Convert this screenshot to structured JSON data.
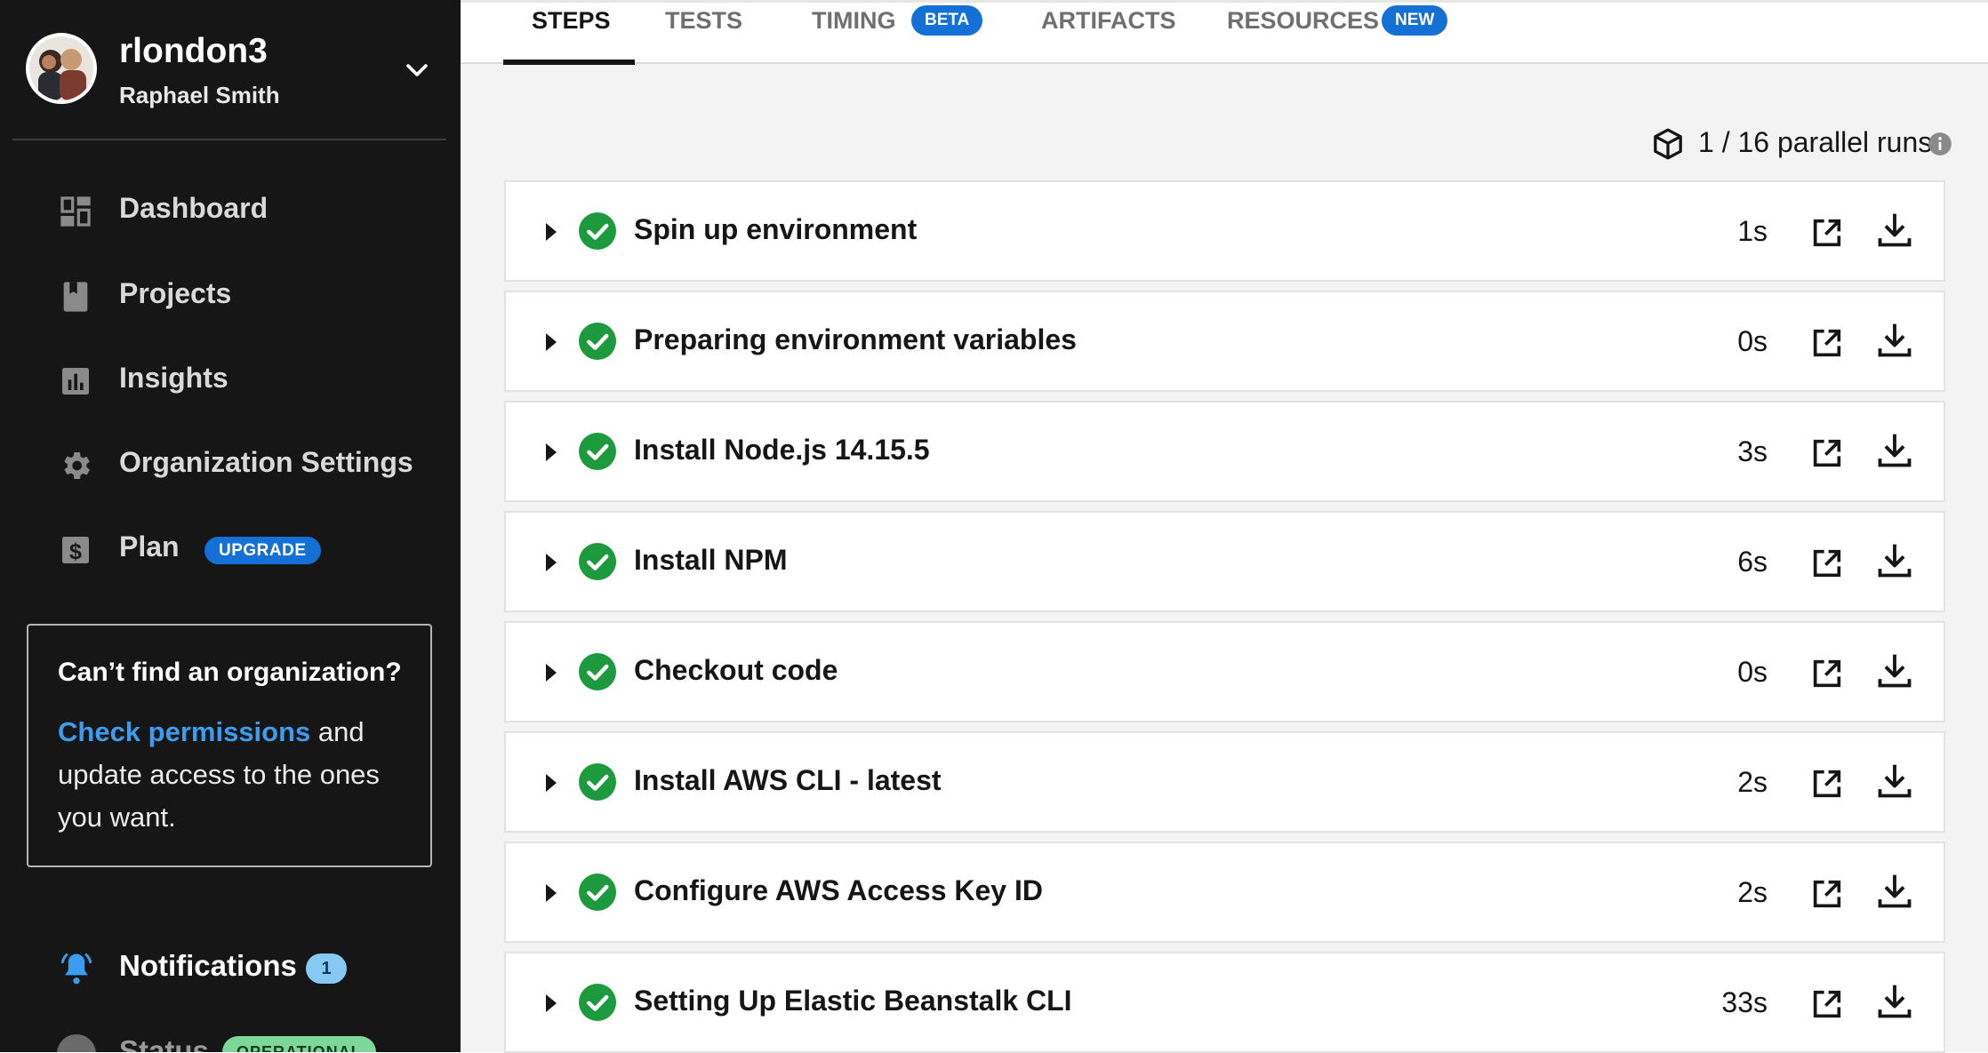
{
  "user": {
    "username": "rlondon3",
    "fullname": "Raphael Smith"
  },
  "sidebar": {
    "items": [
      {
        "label": "Dashboard",
        "icon": "dashboard-icon"
      },
      {
        "label": "Projects",
        "icon": "book-icon"
      },
      {
        "label": "Insights",
        "icon": "bar-chart-icon"
      },
      {
        "label": "Organization Settings",
        "icon": "gear-icon"
      },
      {
        "label": "Plan",
        "icon": "dollar-icon",
        "badge": "UPGRADE"
      }
    ],
    "org_card": {
      "title": "Can’t find an organization?",
      "link": "Check permissions",
      "text": " and update access to the ones you want."
    },
    "notifications": {
      "label": "Notifications",
      "count": "1"
    },
    "status": {
      "label": "Status",
      "badge": "OPERATIONAL"
    }
  },
  "tabs": [
    {
      "label": "STEPS",
      "active": true
    },
    {
      "label": "TESTS"
    },
    {
      "label": "TIMING",
      "badge": "BETA"
    },
    {
      "label": "ARTIFACTS"
    },
    {
      "label": "RESOURCES",
      "badge": "NEW"
    }
  ],
  "parallel_runs": "1 / 16 parallel runs",
  "steps": [
    {
      "name": "Spin up environment",
      "time": "1s"
    },
    {
      "name": "Preparing environment variables",
      "time": "0s"
    },
    {
      "name": "Install Node.js 14.15.5",
      "time": "3s"
    },
    {
      "name": "Install NPM",
      "time": "6s"
    },
    {
      "name": "Checkout code",
      "time": "0s"
    },
    {
      "name": "Install AWS CLI - latest",
      "time": "2s"
    },
    {
      "name": "Configure AWS Access Key ID",
      "time": "2s"
    },
    {
      "name": "Setting Up Elastic Beanstalk CLI",
      "time": "33s"
    }
  ],
  "colors": {
    "success": "#1e9a3e",
    "accent": "#1570d6",
    "link": "#3b9cf0",
    "sidebar_bg": "#161616"
  }
}
